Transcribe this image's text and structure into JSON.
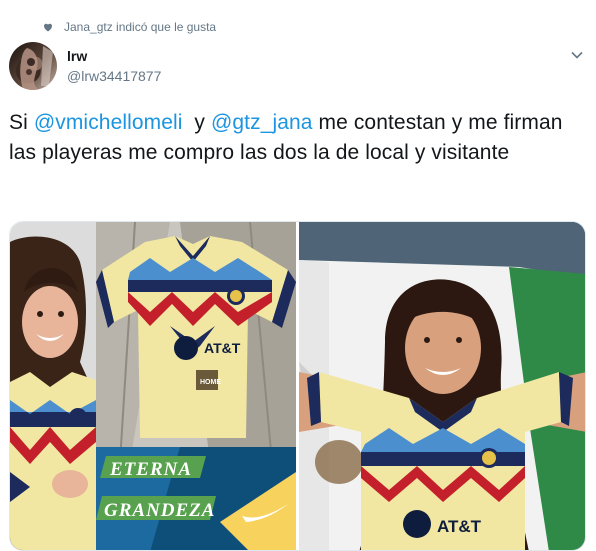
{
  "social_context": {
    "text": "Jana_gtz indicó que le gusta",
    "icon": "heart-icon"
  },
  "author": {
    "name": "lrw",
    "handle": "@lrw34417877"
  },
  "tweet": {
    "segments": [
      {
        "text": "Si ",
        "type": "text"
      },
      {
        "text": "@vmichellomeli",
        "type": "mention"
      },
      {
        "text": "  y ",
        "type": "text"
      },
      {
        "text": "@gtz_jana",
        "type": "mention"
      },
      {
        "text": "  me contestan y me firman las playeras me compro las dos la de local y visitante",
        "type": "text"
      }
    ]
  },
  "media": {
    "left_photo": {
      "banner_top": "ETERNA",
      "banner_bottom": "GRANDEZA",
      "sponsor": "AT&T",
      "shirt_sponsor": "AT&T",
      "home_badge": "HOME"
    },
    "right_photo": {
      "sponsor": "AT&T"
    }
  },
  "colors": {
    "mention": "#1b95e0",
    "secondary_text": "#657786",
    "shirt_yellow": "#f1e7a2",
    "navy": "#1c2a5c",
    "red": "#c4202c"
  }
}
